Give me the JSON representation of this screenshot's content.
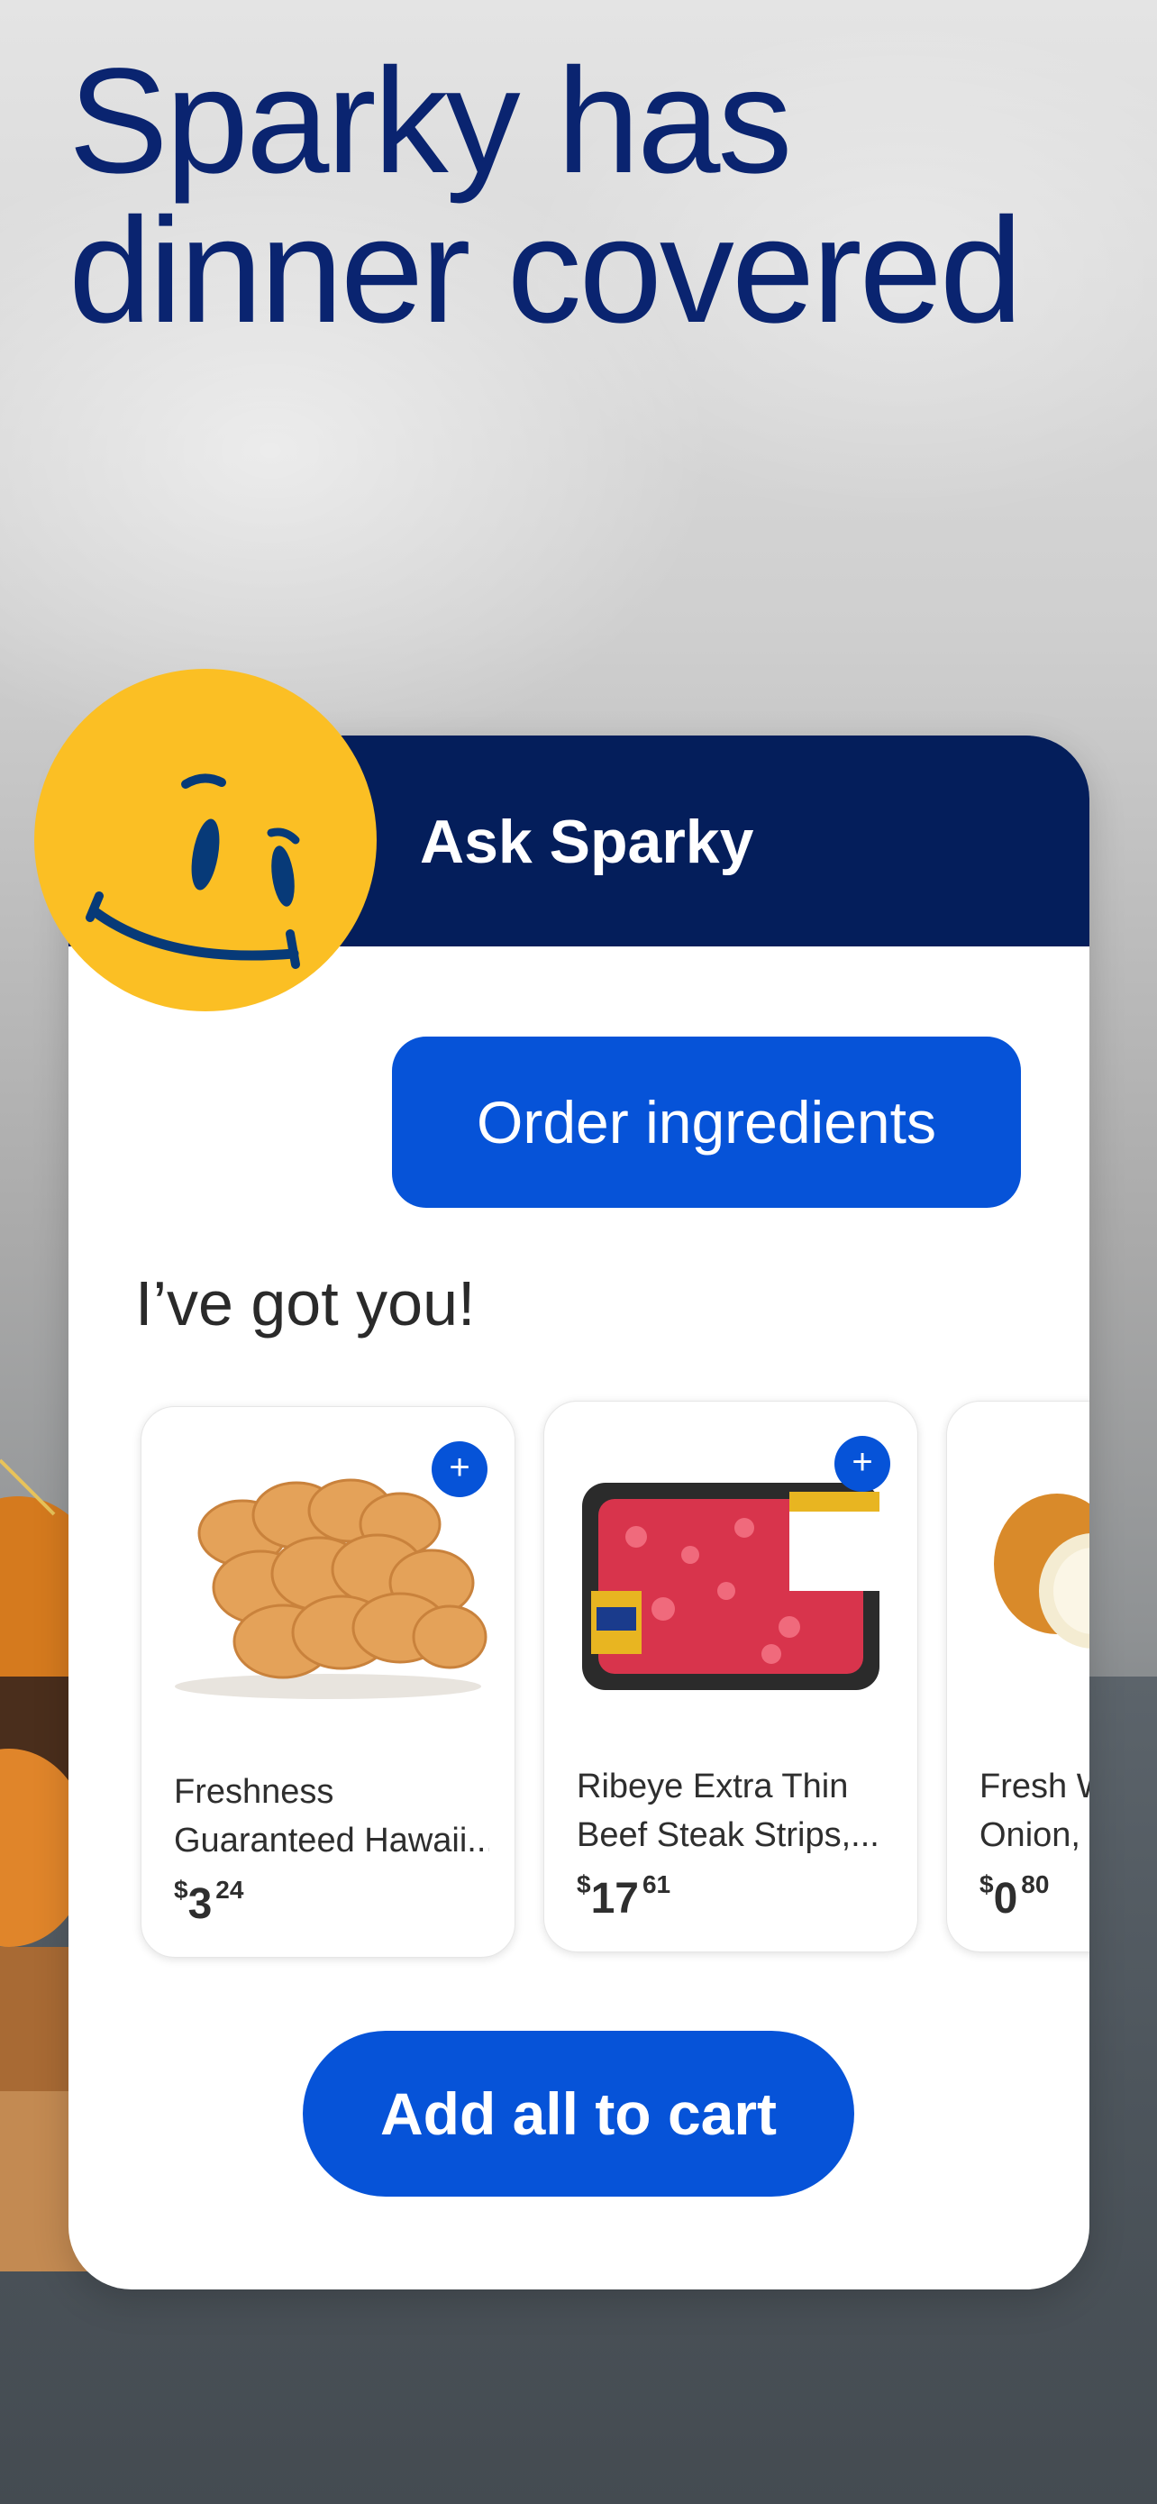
{
  "headline": "Sparky has\ndinner covered",
  "card": {
    "title": "Ask Sparky",
    "user_message": "Order ingredients",
    "assistant_reply": "I’ve got you!",
    "products": [
      {
        "name_line1": "Freshness",
        "name_line2": "Guaranteed Hawaii...",
        "currency": "$",
        "price_dollars": "3",
        "price_cents": "24",
        "add_label": "+",
        "image_icon": "bread-rolls-image"
      },
      {
        "name_line1": "Ribeye Extra Thin",
        "name_line2": "Beef Steak Strips,...",
        "currency": "$",
        "price_dollars": "17",
        "price_cents": "61",
        "add_label": "+",
        "image_icon": "steak-strips-image"
      },
      {
        "name_line1": "Fresh White",
        "name_line2": "Onion, Each",
        "currency": "$",
        "price_dollars": "0",
        "price_cents": "80",
        "add_label": "+",
        "image_icon": "onion-image"
      }
    ],
    "add_all_label": "Add all to cart"
  },
  "colors": {
    "headline": "#0a2470",
    "header_navy": "#041e5b",
    "primary_blue": "#0653d8",
    "spark_yellow": "#fbbf24"
  }
}
